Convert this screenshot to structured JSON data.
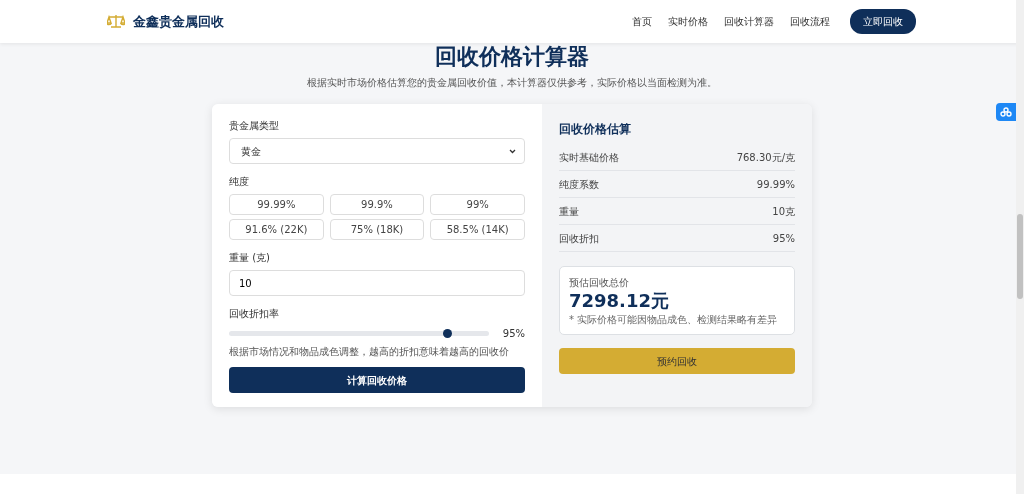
{
  "header": {
    "brand": "金鑫贵金属回收",
    "nav": [
      {
        "label": "首页",
        "kind": "link"
      },
      {
        "label": "实时价格",
        "kind": "link"
      },
      {
        "label": "回收计算器",
        "kind": "link"
      },
      {
        "label": "回收流程",
        "kind": "link"
      },
      {
        "label": "立即回收",
        "kind": "button"
      }
    ]
  },
  "page": {
    "title": "回收价格计算器",
    "subtitle": "根据实时市场价格估算您的贵金属回收价值，本计算器仅供参考，实际价格以当面检测为准。"
  },
  "form": {
    "metal_label": "贵金属类型",
    "metal_value": "黄金",
    "purity_label": "纯度",
    "purities": [
      {
        "label": "99.99%",
        "selected": false
      },
      {
        "label": "99.9%",
        "selected": false
      },
      {
        "label": "99%",
        "selected": false
      },
      {
        "label": "91.6% (22K)",
        "selected": false
      },
      {
        "label": "75% (18K)",
        "selected": false
      },
      {
        "label": "58.5% (14K)",
        "selected": false
      }
    ],
    "weight_label": "重量 (克)",
    "weight_value": "10",
    "discount_label": "回收折扣率",
    "discount": {
      "level": 0.84,
      "reading": "95%"
    },
    "discount_hint": "根据市场情况和物品成色调整，越高的折扣意味着越高的回收价",
    "submit": "计算回收价格"
  },
  "result": {
    "title": "回收价格估算",
    "rows": [
      {
        "label": "实时基础价格",
        "value": "768.30元/克"
      },
      {
        "label": "纯度系数",
        "value": "99.99%"
      },
      {
        "label": "重量",
        "value": "10克"
      },
      {
        "label": "回收折扣",
        "value": "95%"
      }
    ],
    "total_label": "预估回收总价",
    "total": "7298.12元",
    "note": "* 实际价格可能因物品成色、检测结果略有差异",
    "book": "预约回收"
  }
}
